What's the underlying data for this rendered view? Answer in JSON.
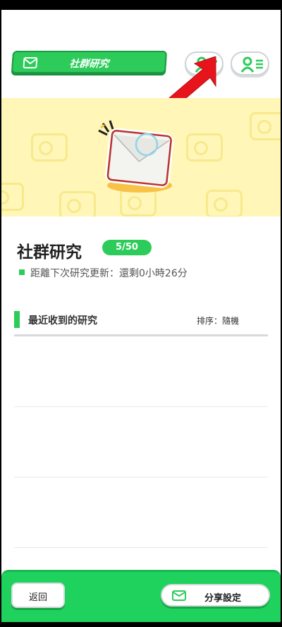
{
  "header": {
    "title": "社群研究",
    "add_friend_icon": "person-plus-icon",
    "friend_list_icon": "person-list-icon"
  },
  "main": {
    "heading": "社群研究",
    "count": "5/50",
    "update_text": "距離下次研究更新：還剩0小時26分"
  },
  "section": {
    "title": "最近收到的研究",
    "sort": "排序：隨機"
  },
  "footer": {
    "back_label": "返回",
    "share_label": "分享設定"
  },
  "colors": {
    "accent": "#2dcc5a",
    "banner": "#fff6b8",
    "arrow": "#e8141c"
  }
}
